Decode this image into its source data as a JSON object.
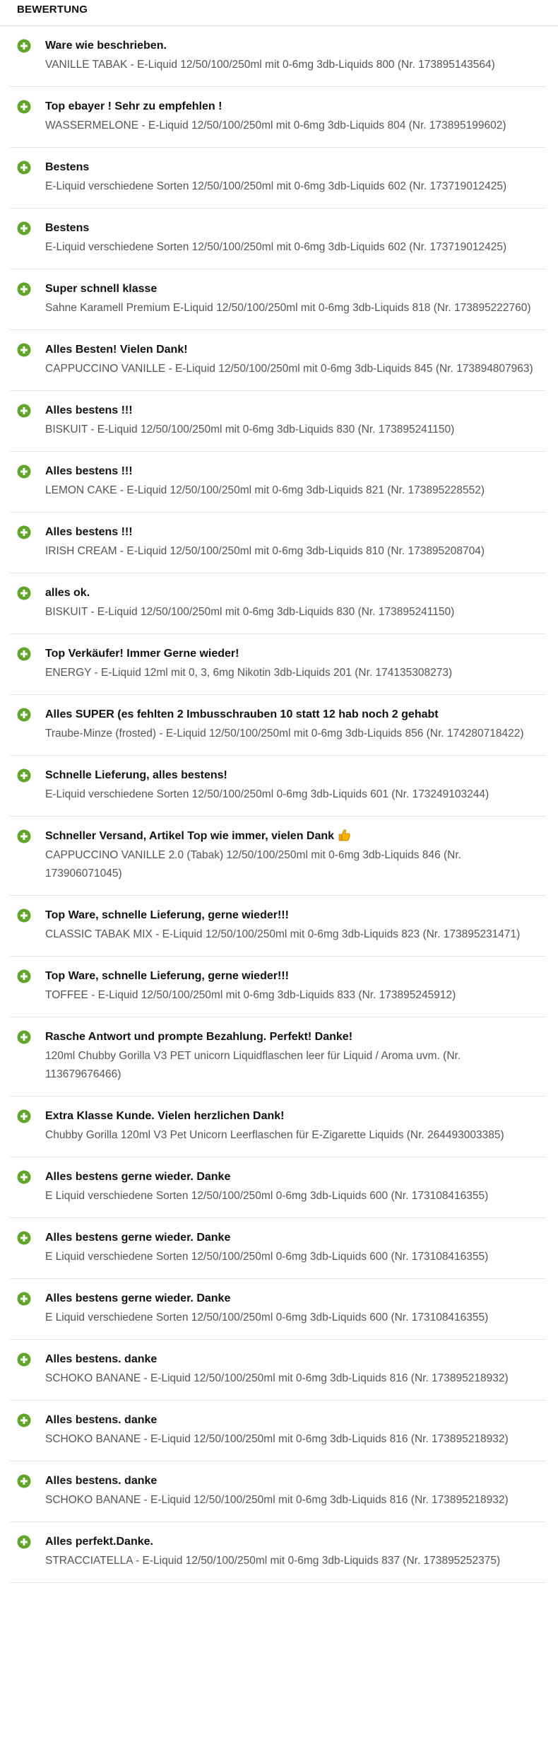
{
  "header": {
    "title": "BEWERTUNG"
  },
  "colors": {
    "positive_icon": "#5fa42b"
  },
  "icons": {
    "rating": "plus-circle-icon",
    "emoji": "thumbs-up-icon"
  },
  "feedback": [
    {
      "comment": "Ware wie beschrieben.",
      "item": "VANILLE TABAK - E-Liquid 12/50/100/250ml mit 0-6mg 3db-Liquids 800 (Nr. 173895143564)"
    },
    {
      "comment": "Top ebayer ! Sehr zu empfehlen !",
      "item": "WASSERMELONE - E-Liquid 12/50/100/250ml mit 0-6mg 3db-Liquids 804 (Nr. 173895199602)"
    },
    {
      "comment": "Bestens",
      "item": "E-Liquid verschiedene Sorten 12/50/100/250ml mit 0-6mg 3db-Liquids 602 (Nr. 173719012425)"
    },
    {
      "comment": "Bestens",
      "item": "E-Liquid verschiedene Sorten 12/50/100/250ml mit 0-6mg 3db-Liquids 602 (Nr. 173719012425)"
    },
    {
      "comment": "Super schnell klasse",
      "item": "Sahne Karamell Premium E-Liquid 12/50/100/250ml mit 0-6mg 3db-Liquids 818 (Nr. 173895222760)"
    },
    {
      "comment": "Alles Besten! Vielen Dank!",
      "item": "CAPPUCCINO VANILLE - E-Liquid 12/50/100/250ml mit 0-6mg 3db-Liquids 845 (Nr. 173894807963)"
    },
    {
      "comment": "Alles bestens !!!",
      "item": "BISKUIT - E-Liquid 12/50/100/250ml mit 0-6mg 3db-Liquids 830 (Nr. 173895241150)"
    },
    {
      "comment": "Alles bestens !!!",
      "item": "LEMON CAKE - E-Liquid 12/50/100/250ml mit 0-6mg 3db-Liquids 821 (Nr. 173895228552)"
    },
    {
      "comment": "Alles bestens !!!",
      "item": "IRISH CREAM - E-Liquid 12/50/100/250ml mit 0-6mg 3db-Liquids 810 (Nr. 173895208704)"
    },
    {
      "comment": "alles ok.",
      "item": "BISKUIT - E-Liquid 12/50/100/250ml mit 0-6mg 3db-Liquids 830 (Nr. 173895241150)"
    },
    {
      "comment": "Top Verkäufer! Immer Gerne wieder!",
      "item": "ENERGY - E-Liquid 12ml mit 0, 3, 6mg Nikotin 3db-Liquids 201 (Nr. 174135308273)"
    },
    {
      "comment": "Alles SUPER (es fehlten 2 Imbusschrauben 10 statt 12 hab noch 2 gehabt",
      "item": "Traube-Minze (frosted) - E-Liquid 12/50/100/250ml mit 0-6mg 3db-Liquids 856 (Nr. 174280718422)"
    },
    {
      "comment": "Schnelle Lieferung, alles bestens!",
      "item": "E-Liquid verschiedene Sorten 12/50/100/250ml 0-6mg 3db-Liquids 601 (Nr. 173249103244)"
    },
    {
      "comment": "Schneller Versand, Artikel Top wie immer, vielen Dank",
      "emoji": true,
      "item": "CAPPUCCINO VANILLE 2.0 (Tabak) 12/50/100/250ml mit 0-6mg 3db-Liquids 846 (Nr. 173906071045)"
    },
    {
      "comment": "Top Ware, schnelle Lieferung, gerne wieder!!!",
      "item": "CLASSIC TABAK MIX - E-Liquid 12/50/100/250ml mit 0-6mg 3db-Liquids 823 (Nr. 173895231471)"
    },
    {
      "comment": "Top Ware, schnelle Lieferung, gerne wieder!!!",
      "item": "TOFFEE - E-Liquid 12/50/100/250ml mit 0-6mg 3db-Liquids 833 (Nr. 173895245912)"
    },
    {
      "comment": "Rasche Antwort und prompte Bezahlung. Perfekt! Danke!",
      "item": "120ml Chubby Gorilla V3 PET unicorn Liquidflaschen leer für Liquid / Aroma uvm. (Nr. 113679676466)"
    },
    {
      "comment": "Extra Klasse Kunde. Vielen herzlichen Dank!",
      "item": "Chubby Gorilla 120ml V3 Pet Unicorn Leerflaschen für E-Zigarette Liquids (Nr. 264493003385)"
    },
    {
      "comment": "Alles bestens gerne wieder. Danke",
      "item": "E Liquid verschiedene Sorten 12/50/100/250ml 0-6mg 3db-Liquids 600 (Nr. 173108416355)"
    },
    {
      "comment": "Alles bestens gerne wieder. Danke",
      "item": "E Liquid verschiedene Sorten 12/50/100/250ml 0-6mg 3db-Liquids 600 (Nr. 173108416355)"
    },
    {
      "comment": "Alles bestens gerne wieder. Danke",
      "item": "E Liquid verschiedene Sorten 12/50/100/250ml 0-6mg 3db-Liquids 600 (Nr. 173108416355)"
    },
    {
      "comment": "Alles bestens. danke",
      "item": "SCHOKO BANANE - E-Liquid 12/50/100/250ml mit 0-6mg 3db-Liquids 816 (Nr. 173895218932)"
    },
    {
      "comment": "Alles bestens. danke",
      "item": "SCHOKO BANANE - E-Liquid 12/50/100/250ml mit 0-6mg 3db-Liquids 816 (Nr. 173895218932)"
    },
    {
      "comment": "Alles bestens. danke",
      "item": "SCHOKO BANANE - E-Liquid 12/50/100/250ml mit 0-6mg 3db-Liquids 816 (Nr. 173895218932)"
    },
    {
      "comment": "Alles perfekt.Danke.",
      "item": "STRACCIATELLA - E-Liquid 12/50/100/250ml mit 0-6mg 3db-Liquids 837 (Nr. 173895252375)"
    }
  ]
}
